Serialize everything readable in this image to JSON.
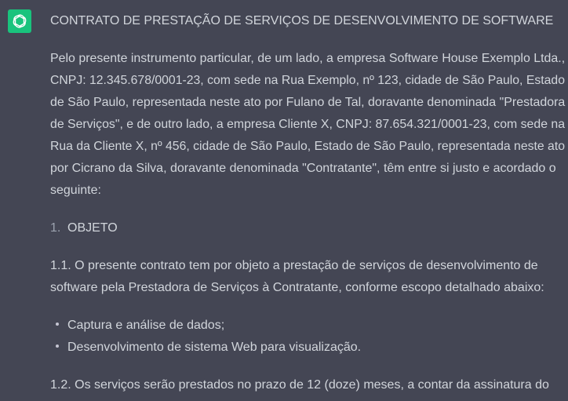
{
  "assistant": {
    "avatar_icon": "openai-logo-icon",
    "avatar_color": "#19c37d"
  },
  "message": {
    "title": "CONTRATO DE PRESTAÇÃO DE SERVIÇOS DE DESENVOLVIMENTO DE SOFTWARE",
    "intro_lines": [
      "Pelo presente instrumento particular, de um lado, a empresa Software House Exemplo Ltda.,",
      "CNPJ: 12.345.678/0001-23, com sede na Rua Exemplo, nº 123, cidade de São Paulo, Estado",
      "de São Paulo, representada neste ato por Fulano de Tal, doravante denominada \"Prestadora",
      "de Serviços\", e de outro lado, a empresa Cliente X, CNPJ: 87.654.321/0001-23, com sede na",
      "Rua da Cliente X, nº 456, cidade de São Paulo, Estado de São Paulo, representada neste ato",
      "por Cicrano da Silva, doravante denominada \"Contratante\", têm entre si justo e acordado o",
      "seguinte:"
    ],
    "section1": {
      "number": "1.",
      "heading": "OBJETO"
    },
    "clause_1_1_lines": [
      "1.1. O presente contrato tem por objeto a prestação de serviços de desenvolvimento de",
      "software pela Prestadora de Serviços à Contratante, conforme escopo detalhado abaixo:"
    ],
    "scope_items": [
      "Captura e análise de dados;",
      "Desenvolvimento de sistema Web para visualização."
    ],
    "clause_1_2_lines": [
      "1.2. Os serviços serão prestados no prazo de 12 (doze) meses, a contar da assinatura do"
    ]
  }
}
